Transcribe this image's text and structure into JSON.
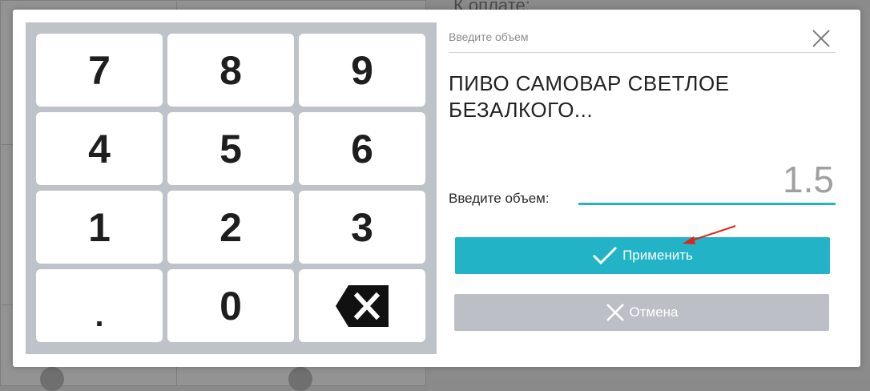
{
  "background": {
    "title_fragment": "К оплате:"
  },
  "keypad": {
    "keys": [
      "7",
      "8",
      "9",
      "4",
      "5",
      "6",
      "1",
      "2",
      "3",
      ".",
      "0"
    ],
    "backspace_icon": "backspace-icon"
  },
  "dialog": {
    "field_hint": "Введите объем",
    "close_icon": "close-icon",
    "product_name": "ПИВО САМОВАР СВЕТЛОЕ БЕЗАЛКОГО...",
    "volume_label": "Введите объем:",
    "volume_value": "1.5",
    "apply_label": "Применить",
    "cancel_label": "Отмена"
  },
  "colors": {
    "accent": "#22b4c6",
    "keypad_bg": "#bec3c9",
    "cancel_bg": "#bcc0c6",
    "annotation_arrow": "#d9261c"
  }
}
